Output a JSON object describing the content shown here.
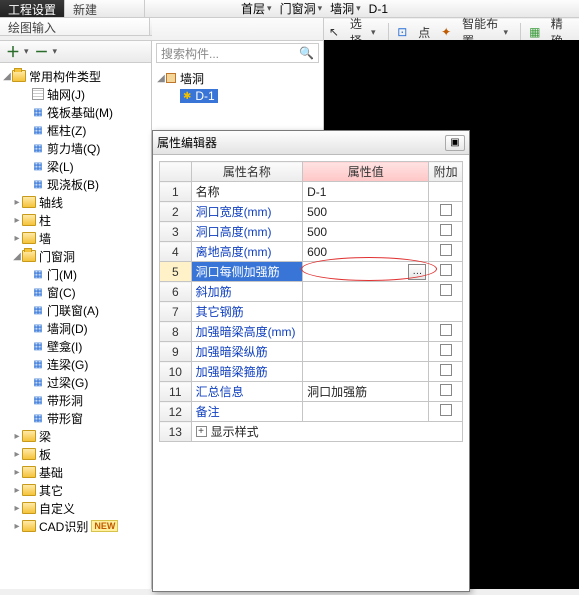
{
  "top": {
    "tab_left_a": "工程设置",
    "tab_left_b": "绘图输入",
    "tab_mid": "新建",
    "dd_floor": "首层",
    "dd_cat": "门窗洞",
    "dd_wall": "墙洞",
    "dd_item": "D-1"
  },
  "toolbar": {
    "select": "选择",
    "point": "点",
    "smart_layout": "智能布置",
    "precise": "精确"
  },
  "mid": {
    "search_placeholder": "搜索构件...",
    "root": "墙洞",
    "item": "D-1"
  },
  "tree": {
    "root": "常用构件类型",
    "items_a": [
      "轴网(J)",
      "筏板基础(M)",
      "框柱(Z)",
      "剪力墙(Q)",
      "梁(L)",
      "现浇板(B)"
    ],
    "folders_b": [
      "轴线",
      "柱",
      "墙"
    ],
    "folder_open": "门窗洞",
    "items_c": [
      "门(M)",
      "窗(C)",
      "门联窗(A)",
      "墙洞(D)",
      "壁龛(I)",
      "连梁(G)",
      "过梁(G)",
      "带形洞",
      "带形窗"
    ],
    "folders_d": [
      "梁",
      "板",
      "基础",
      "其它",
      "自定义",
      "CAD识别"
    ],
    "new_badge": "NEW"
  },
  "dialog": {
    "title": "属性编辑器",
    "col_name": "属性名称",
    "col_value": "属性值",
    "col_extra": "附加",
    "rows": [
      {
        "n": "1",
        "name": "名称",
        "val": "D-1",
        "black": true,
        "chk": false
      },
      {
        "n": "2",
        "name": "洞口宽度(mm)",
        "val": "500",
        "chk": true
      },
      {
        "n": "3",
        "name": "洞口高度(mm)",
        "val": "500",
        "chk": true
      },
      {
        "n": "4",
        "name": "离地高度(mm)",
        "val": "600",
        "chk": true
      },
      {
        "n": "5",
        "name": "洞口每侧加强筋",
        "val": "",
        "chk": true,
        "sel": true,
        "dots": true
      },
      {
        "n": "6",
        "name": "斜加筋",
        "val": "",
        "chk": true
      },
      {
        "n": "7",
        "name": "其它钢筋",
        "val": "",
        "chk": false
      },
      {
        "n": "8",
        "name": "加强暗梁高度(mm)",
        "val": "",
        "chk": true
      },
      {
        "n": "9",
        "name": "加强暗梁纵筋",
        "val": "",
        "chk": true
      },
      {
        "n": "10",
        "name": "加强暗梁箍筋",
        "val": "",
        "chk": true
      },
      {
        "n": "11",
        "name": "汇总信息",
        "val": "洞口加强筋",
        "chk": true
      },
      {
        "n": "12",
        "name": "备注",
        "val": "",
        "chk": true
      }
    ],
    "row13": "显示样式"
  }
}
